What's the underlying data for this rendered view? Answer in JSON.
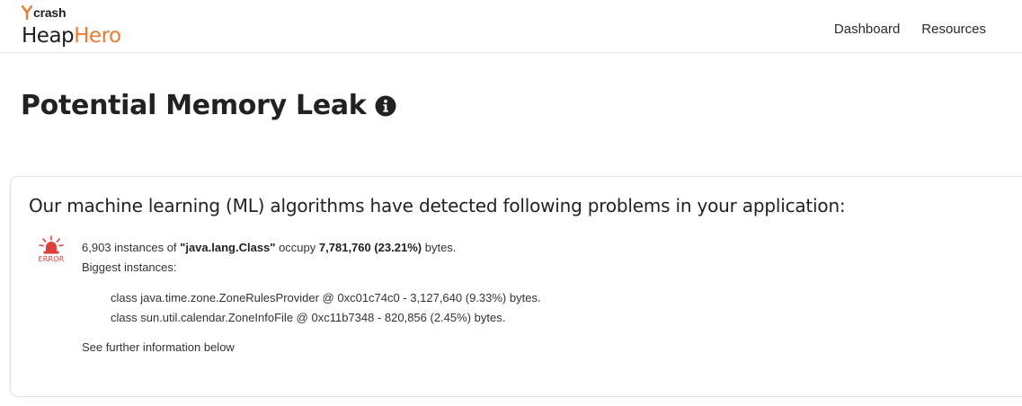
{
  "header": {
    "logo_small": "crash",
    "logo_part1": "Heap",
    "logo_part2": "Hero",
    "nav": [
      {
        "label": "Dashboard"
      },
      {
        "label": "Resources"
      }
    ]
  },
  "page": {
    "title": "Potential Memory Leak"
  },
  "card": {
    "heading": "Our machine learning (ML) algorithms have detected following problems in your application:",
    "error_label": "ERROR",
    "problem": {
      "count": "6,903",
      "instances_of": "instances of",
      "class_name": "\"java.lang.Class\"",
      "occupy": "occupy",
      "bytes_value": "7,781,760 (23.21%)",
      "bytes_suffix": "bytes.",
      "biggest_label": "Biggest instances:"
    },
    "instances": [
      "class java.time.zone.ZoneRulesProvider @ 0xc01c74c0 - 3,127,640 (9.33%) bytes.",
      "class sun.util.calendar.ZoneInfoFile @ 0xc11b7348 - 820,856 (2.45%) bytes."
    ],
    "see_further": "See further information below"
  },
  "colors": {
    "brand_orange": "#ef7a2f",
    "error_red": "#e0403a"
  }
}
